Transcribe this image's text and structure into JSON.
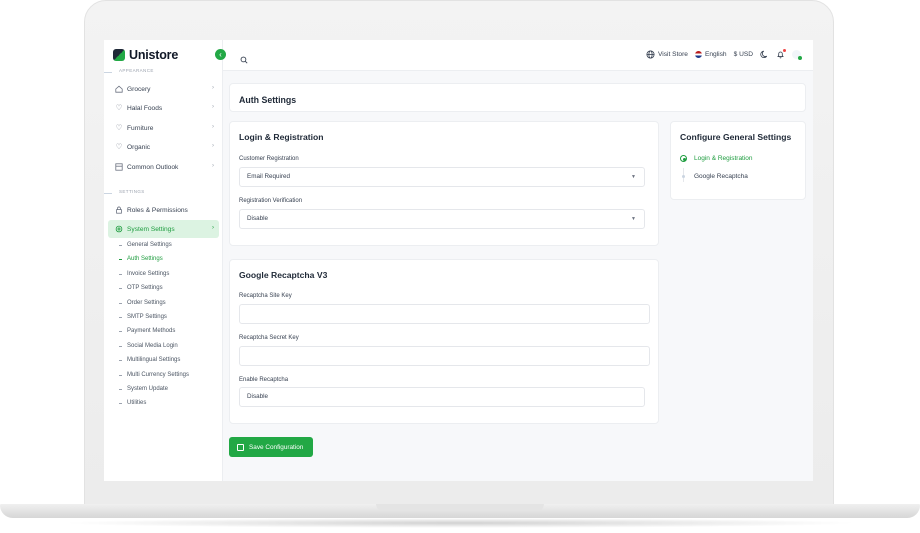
{
  "brand": {
    "name": "Unistore"
  },
  "sidebar": {
    "section_top": "APPEARANCE",
    "items": [
      {
        "label": "Grocery",
        "icon": "home-icon"
      },
      {
        "label": "Halal Foods",
        "icon": "heart-icon"
      },
      {
        "label": "Furniture",
        "icon": "heart-icon"
      },
      {
        "label": "Organic",
        "icon": "heart-icon"
      },
      {
        "label": "Common Outlook",
        "icon": "layout-icon"
      }
    ],
    "section_settings": "SETTINGS",
    "settings_items": [
      {
        "label": "Roles & Permissions",
        "icon": "lock-icon"
      },
      {
        "label": "System Settings",
        "icon": "gear-icon"
      }
    ],
    "sub_items": [
      "General Settings",
      "Auth Settings",
      "Invoice Settings",
      "OTP Settings",
      "Order Settings",
      "SMTP Settings",
      "Payment Methods",
      "Social Media Login",
      "Multilingual Settings",
      "Multi Currency Settings",
      "System Update",
      "Utilities"
    ]
  },
  "topbar": {
    "visit_store": "Visit Store",
    "language": "English",
    "currency": "$ USD"
  },
  "page": {
    "title": "Auth Settings"
  },
  "login_card": {
    "title": "Login & Registration",
    "customer_registration_label": "Customer Registration",
    "customer_registration_value": "Email Required",
    "registration_verification_label": "Registration Verification",
    "registration_verification_value": "Disable"
  },
  "recaptcha_card": {
    "title": "Google Recaptcha V3",
    "site_key_label": "Recaptcha Site Key",
    "site_key_value": "",
    "secret_key_label": "Recaptcha Secret Key",
    "secret_key_value": "",
    "enable_label": "Enable Recaptcha",
    "enable_value": "Disable"
  },
  "save_button": "Save Configuration",
  "configure_card": {
    "title": "Configure General Settings",
    "steps": [
      "Login & Registration",
      "Google Recaptcha"
    ]
  },
  "colors": {
    "accent": "#22a845",
    "active_bg": "#dcf3e2"
  }
}
